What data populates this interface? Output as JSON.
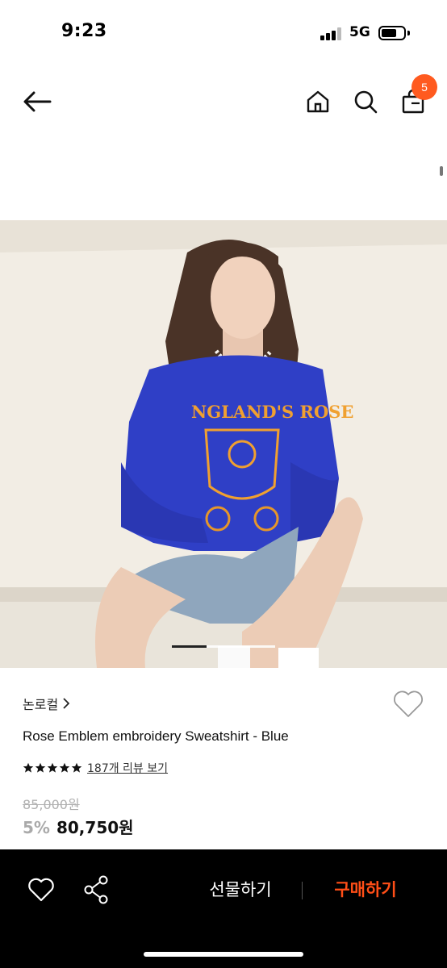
{
  "status_bar": {
    "time": "9:23",
    "network": "5G"
  },
  "nav": {
    "cart_count": "5"
  },
  "product": {
    "brand": "논로컬",
    "name": "Rose Emblem embroidery Sweatshirt - Blue",
    "rating_stars": 5,
    "review_link": "187개 리뷰 보기",
    "original_price": "85,000원",
    "discount": "5%",
    "sale_price": "80,750원",
    "image": {
      "shirt_print": "NGLAND'S ROSE",
      "shirt_color": "#2f3fc6",
      "print_color": "#f0a030"
    }
  },
  "carousel": {
    "active_index": 0,
    "total": 3
  },
  "bottom_bar": {
    "gift_label": "선물하기",
    "buy_label": "구매하기",
    "buy_color": "#ff4e17"
  },
  "icons": [
    "back-arrow-icon",
    "home-icon",
    "search-icon",
    "cart-icon",
    "heart-outline-icon",
    "star-icon",
    "share-icon"
  ]
}
